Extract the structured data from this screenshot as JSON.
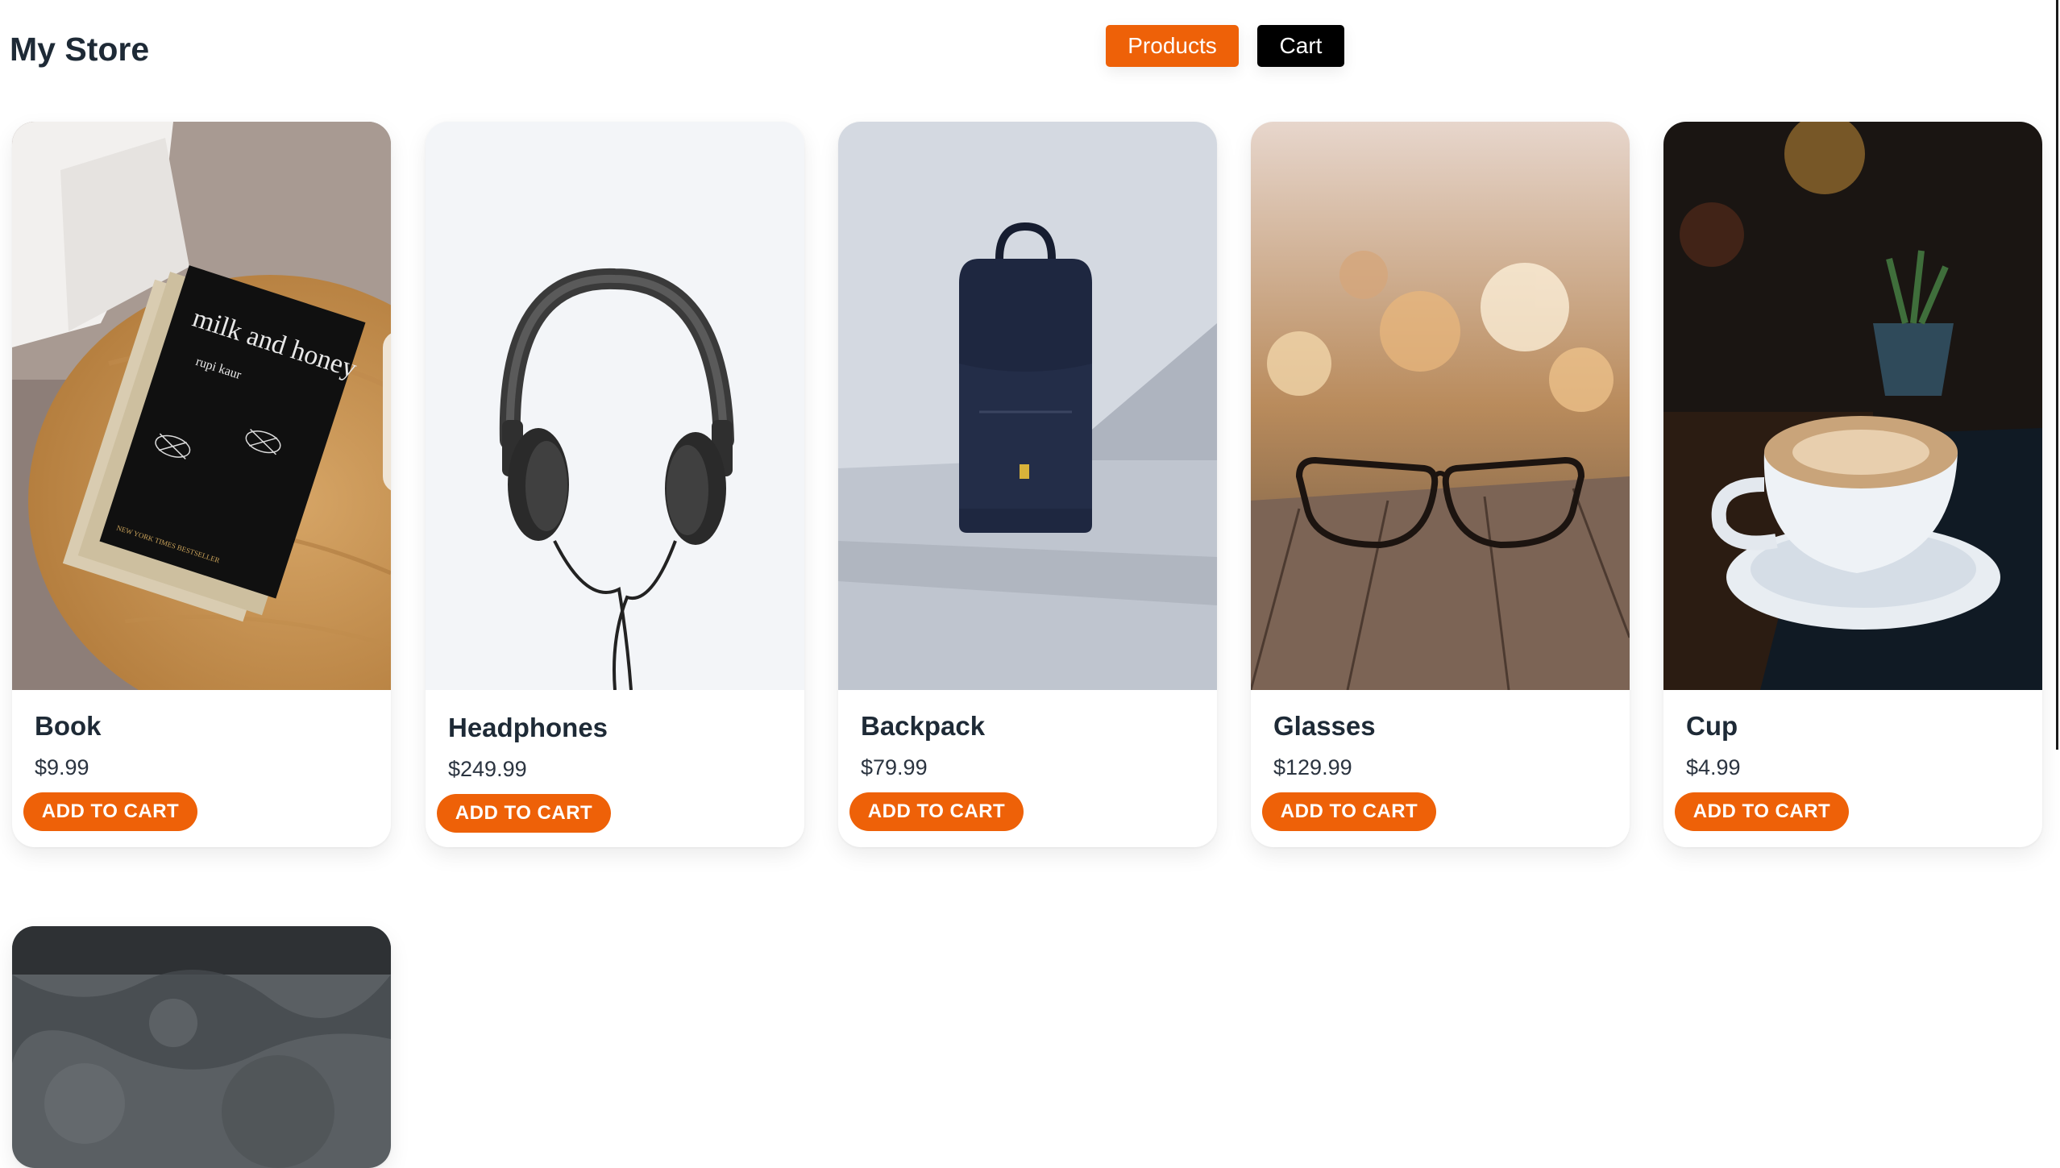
{
  "store": {
    "title": "My Store"
  },
  "nav": {
    "products_label": "Products",
    "cart_label": "Cart"
  },
  "products": [
    {
      "name": "Book",
      "price": "$9.99",
      "button": "ADD TO CART",
      "image": "book-photo"
    },
    {
      "name": "Headphones",
      "price": "$249.99",
      "button": "ADD TO CART",
      "image": "headphones-photo"
    },
    {
      "name": "Backpack",
      "price": "$79.99",
      "button": "ADD TO CART",
      "image": "backpack-photo"
    },
    {
      "name": "Glasses",
      "price": "$129.99",
      "button": "ADD TO CART",
      "image": "glasses-photo"
    },
    {
      "name": "Cup",
      "price": "$4.99",
      "button": "ADD TO CART",
      "image": "cup-photo"
    },
    {
      "image": "concrete-photo"
    }
  ],
  "book_cover": {
    "title": "milk and honey",
    "author": "rupi kaur",
    "tagline": "NEW YORK TIMES BESTSELLER"
  },
  "colors": {
    "accent": "#ee6108",
    "cart_button": "#000000",
    "text": "#1e2a36"
  }
}
